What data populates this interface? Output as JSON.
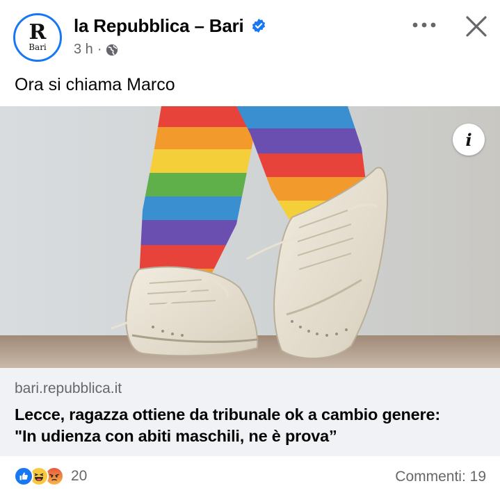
{
  "header": {
    "avatar": {
      "logo_letter": "R",
      "logo_sub": "Bari"
    },
    "page_name": "la Repubblica – Bari",
    "time": "3 h",
    "separator": "·",
    "icons": [
      "verified-icon",
      "globe-icon",
      "more-icon",
      "close-icon"
    ]
  },
  "post": {
    "text": "Ora si chiama Marco",
    "image": {
      "subject": "rainbow-socks-white-brogue-shoes",
      "info_icon_label": "i"
    }
  },
  "link": {
    "domain": "bari.repubblica.it",
    "title_line1": "Lecce, ragazza ottiene da tribunale ok a cambio genere:",
    "title_line2": "\"In udienza con abiti maschili, ne è prova”"
  },
  "footer": {
    "reactions": [
      "like",
      "haha",
      "angry"
    ],
    "reaction_count": "20",
    "comments": "Commenti: 19"
  },
  "colors": {
    "accent": "#1877f2",
    "secondary_text": "#65676b",
    "link_card_bg": "#f0f2f5"
  }
}
